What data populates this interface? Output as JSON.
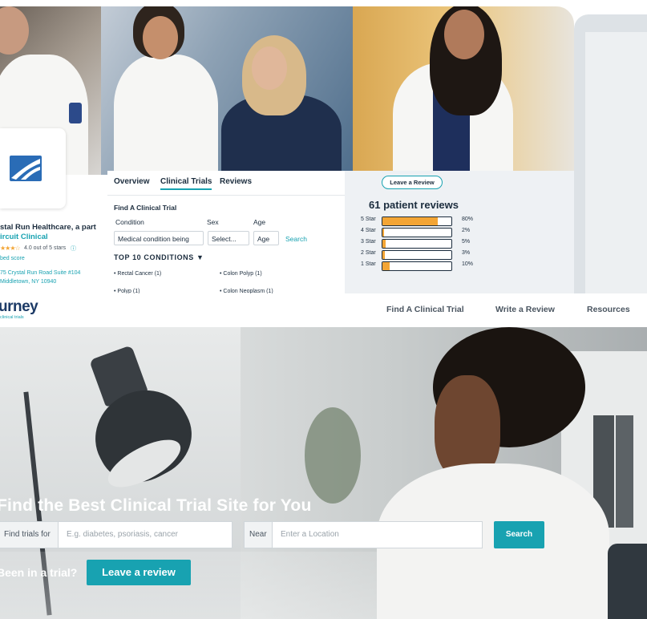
{
  "profile": {
    "practice_name_line1": "stal Run Healthcare, a part",
    "practice_name_line2": "ircuit Clinical",
    "rating_text": "4.0 out of 5 stars",
    "rating_stars": 4,
    "rating_note": "bed score",
    "address_line1": "75 Crystal Run Road Suite #104",
    "address_line2": "Middletown, NY 10940"
  },
  "tabs": [
    {
      "label": "Overview"
    },
    {
      "label": "Clinical Trials"
    },
    {
      "label": "Reviews"
    }
  ],
  "trial_finder": {
    "heading": "Find A Clinical Trial",
    "condition_label": "Condition",
    "sex_label": "Sex",
    "age_label": "Age",
    "condition_value": "Medical condition being",
    "sex_value": "Select...",
    "age_value": "Age",
    "search_link": "Search",
    "top_conditions_heading": "TOP 10 CONDITIONS ▼",
    "conditions": [
      "Rectal Cancer (1)",
      "Colon Polyp (1)",
      "Polyp (1)",
      "Colon Neoplasm (1)"
    ]
  },
  "reviews": {
    "leave_review_label": "Leave a Review",
    "title": "61 patient reviews",
    "rows": [
      {
        "label": "5 Star",
        "pct": "80%",
        "value": 0.8
      },
      {
        "label": "4 Star",
        "pct": "2%",
        "value": 0.02
      },
      {
        "label": "3 Star",
        "pct": "5%",
        "value": 0.05
      },
      {
        "label": "2 Star",
        "pct": "3%",
        "value": 0.03
      },
      {
        "label": "1 Star",
        "pct": "10%",
        "value": 0.1
      }
    ]
  },
  "nav": {
    "logo_text": "urney",
    "logo_sub": "clinical trials",
    "links": [
      "Find A Clinical Trial",
      "Write a Review",
      "Resources"
    ]
  },
  "hero": {
    "title": "Find the Best Clinical Trial Site for You",
    "find_label": "Find trials for",
    "find_placeholder": "E.g. diabetes, psoriasis, cancer",
    "near_label": "Near",
    "near_placeholder": "Enter a Location",
    "search_label": "Search",
    "been_text": "Been in a trial?",
    "leave_review_label": "Leave a review"
  },
  "colors": {
    "accent": "#18a2b1",
    "bar_fill": "#f3a535",
    "navy": "#1c2d3e"
  }
}
